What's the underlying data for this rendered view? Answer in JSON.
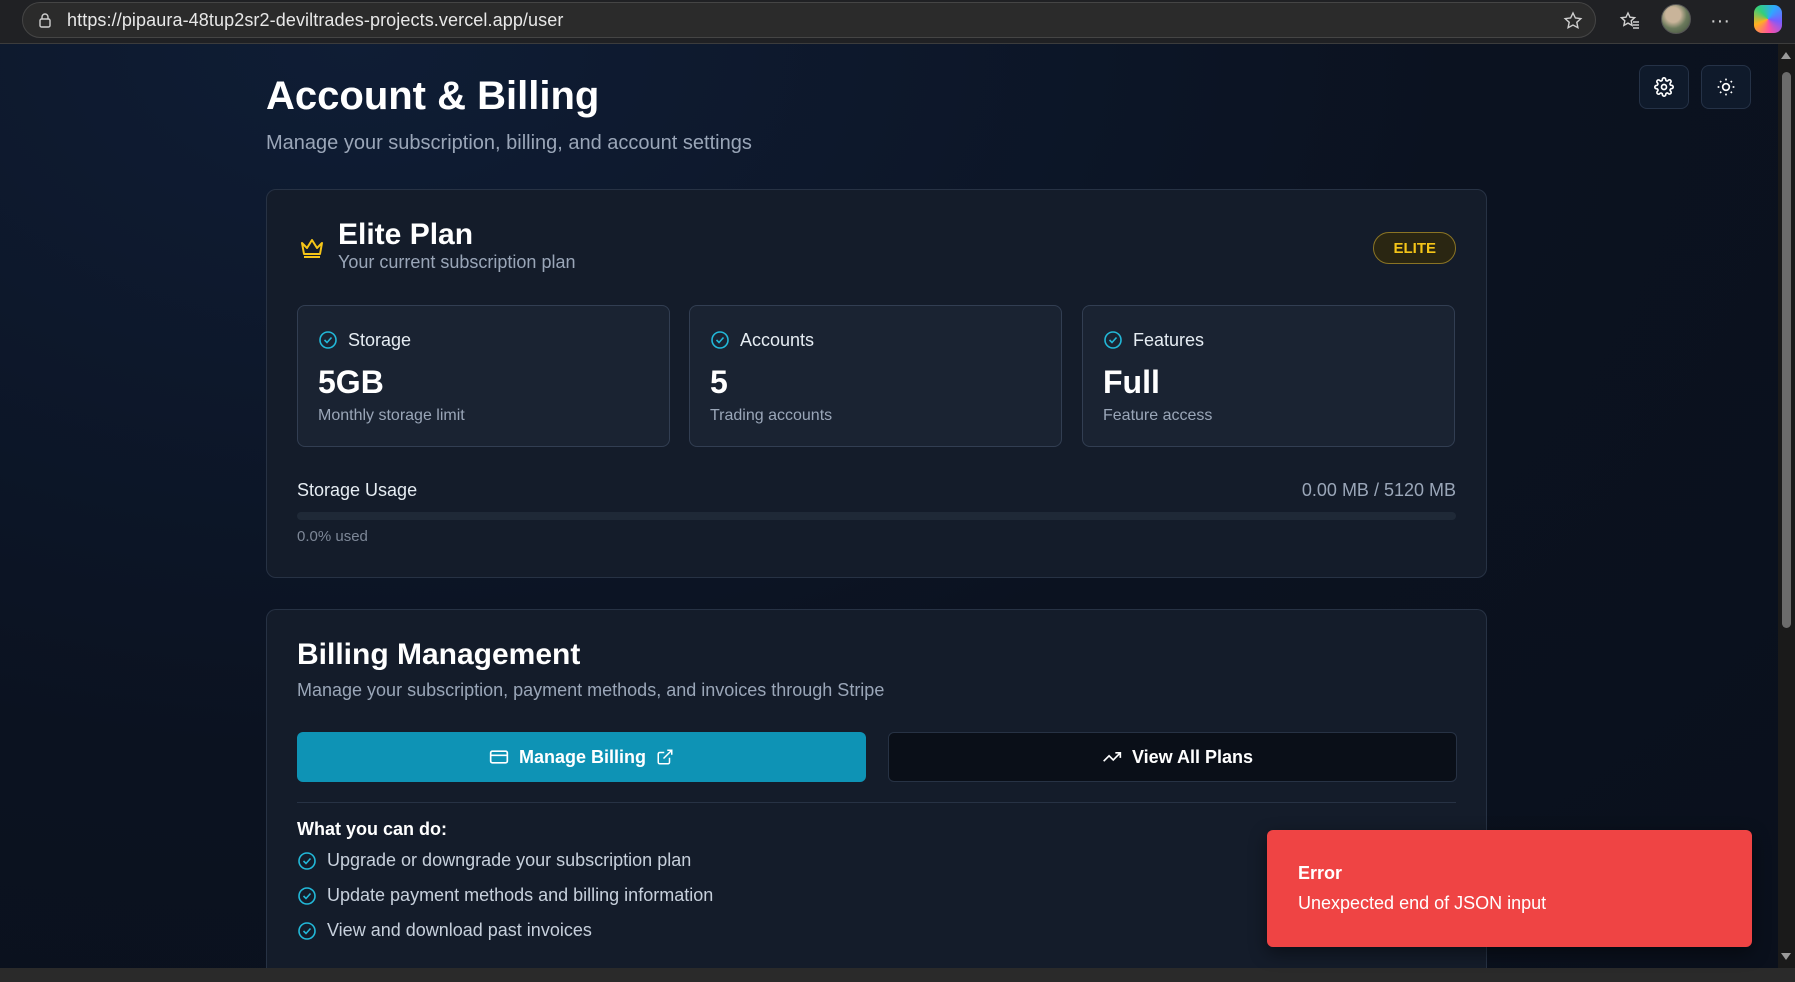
{
  "browser": {
    "url": "https://pipaura-48tup2sr2-deviltrades-projects.vercel.app/user"
  },
  "header": {
    "title": "Account & Billing",
    "subtitle": "Manage your subscription, billing, and account settings"
  },
  "plan": {
    "name": "Elite Plan",
    "subtitle": "Your current subscription plan",
    "badge": "ELITE",
    "stats": [
      {
        "label": "Storage",
        "value": "5GB",
        "description": "Monthly storage limit"
      },
      {
        "label": "Accounts",
        "value": "5",
        "description": "Trading accounts"
      },
      {
        "label": "Features",
        "value": "Full",
        "description": "Feature access"
      }
    ],
    "usage": {
      "label": "Storage Usage",
      "value": "0.00 MB / 5120 MB",
      "percent_text": "0.0% used",
      "fraction": 0.0
    }
  },
  "billing": {
    "title": "Billing Management",
    "subtitle": "Manage your subscription, payment methods, and invoices through Stripe",
    "manage_label": "Manage Billing",
    "plans_label": "View All Plans",
    "can_do_title": "What you can do:",
    "features": [
      "Upgrade or downgrade your subscription plan",
      "Update payment methods and billing information",
      "View and download past invoices"
    ]
  },
  "toast": {
    "title": "Error",
    "message": "Unexpected end of JSON input"
  },
  "colors": {
    "accent": "#22b8d8",
    "primary_button": "#0e93b5",
    "badge_gold": "#f5c518",
    "error": "#ef4444",
    "background": "#0b1220"
  }
}
